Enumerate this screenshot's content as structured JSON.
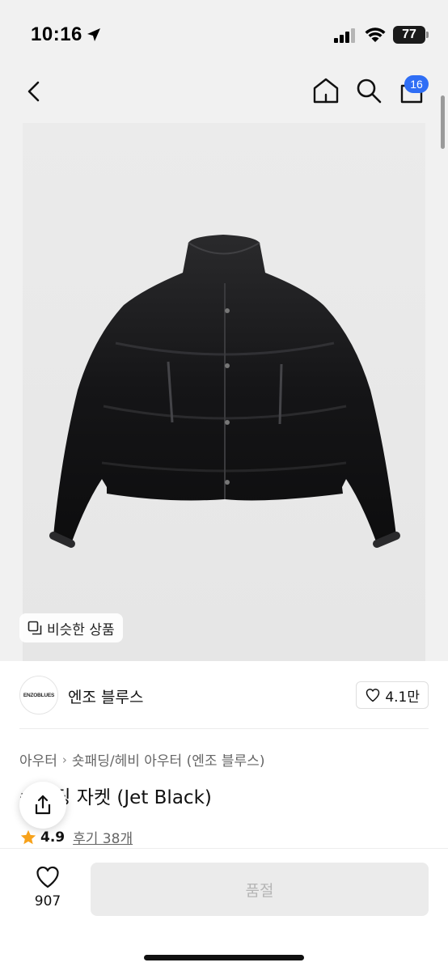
{
  "status_bar": {
    "time": "10:16",
    "battery": "77"
  },
  "nav": {
    "icons": [
      "back-icon",
      "home-icon",
      "search-icon",
      "cart-icon"
    ],
    "cart_badge": "16"
  },
  "image": {
    "similar_button_label": "비슷한 상품"
  },
  "brand": {
    "logo_text": "ENZOBLUES",
    "name": "엔조 블루스",
    "likes": "4.1만"
  },
  "product": {
    "breadcrumb": [
      "아우터",
      "숏패딩/헤비 아우터 (엔조 블루스)"
    ],
    "title": "숏패딩 자켓 (Jet Black)",
    "rating": "4.9",
    "reviews": "후기 38개"
  },
  "bottom_bar": {
    "wish_count": "907",
    "button_label": "품절"
  },
  "colors": {
    "badge": "#2f6ef5",
    "star": "#f7a21b",
    "disabled_button": "#ebebeb"
  }
}
